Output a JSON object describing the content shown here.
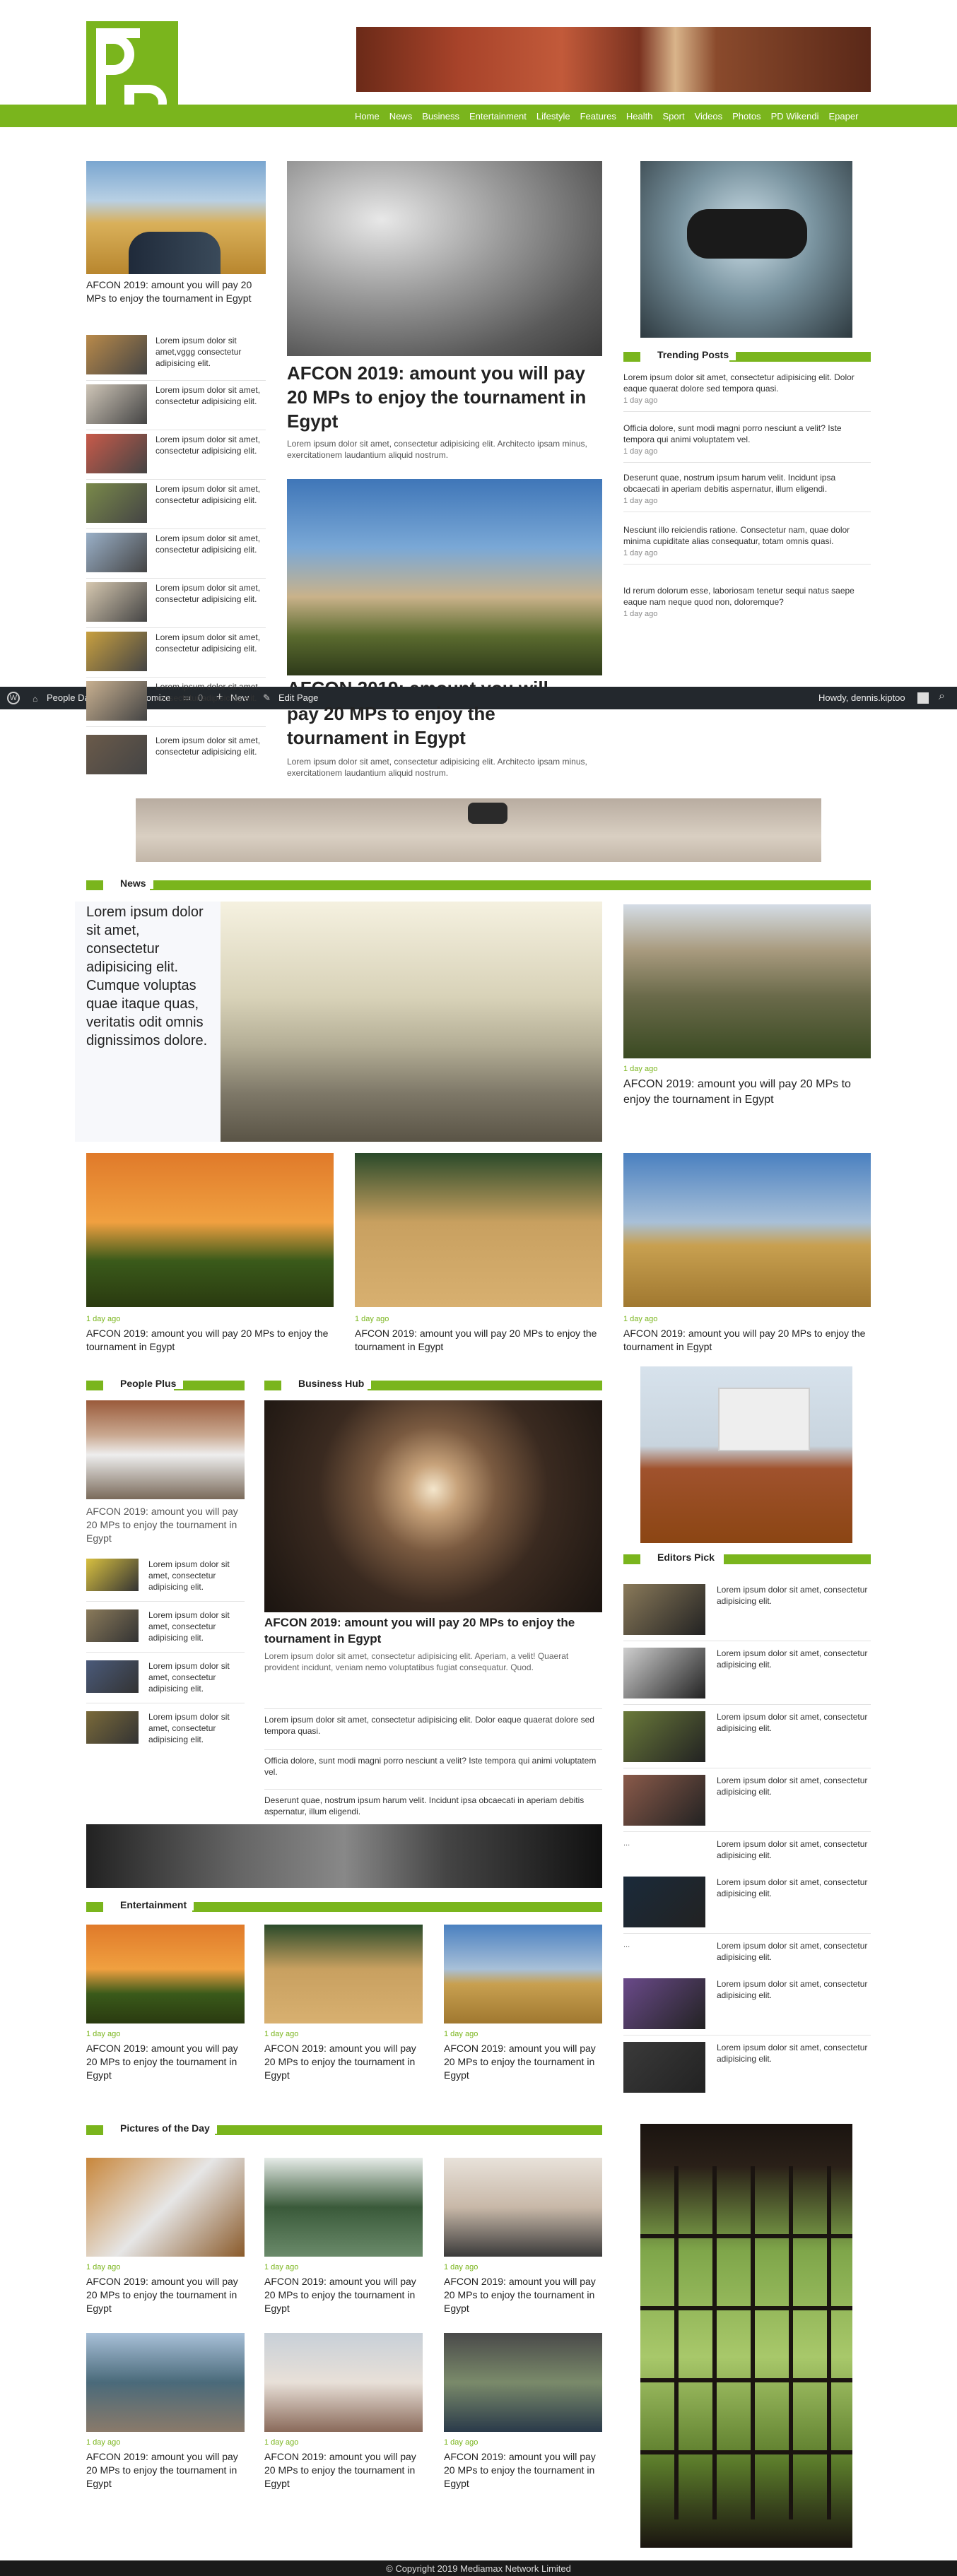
{
  "header": {
    "logo_text": "PD",
    "nav": [
      "Home",
      "News",
      "Business",
      "Entertainment",
      "Lifestyle",
      "Features",
      "Health",
      "Sport",
      "Videos",
      "Photos",
      "PD Wikendi",
      "Epaper"
    ]
  },
  "admin_bar": {
    "site": "People Daily",
    "customize": "Customize",
    "comments": "0",
    "new": "New",
    "edit": "Edit Page",
    "howdy": "Howdy, dennis.kiptoo"
  },
  "left_feature": {
    "caption": "AFCON 2019: amount you will pay 20 MPs to enjoy the tournament in Egypt"
  },
  "left_list": [
    "Lorem ipsum dolor sit amet,vggg consectetur adipisicing elit.",
    "Lorem ipsum dolor sit amet, consectetur adipisicing elit.",
    "Lorem ipsum dolor sit amet, consectetur adipisicing elit.",
    "Lorem ipsum dolor sit amet, consectetur adipisicing elit.",
    "Lorem ipsum dolor sit amet, consectetur adipisicing elit.",
    "Lorem ipsum dolor sit amet, consectetur adipisicing elit.",
    "Lorem ipsum dolor sit amet, consectetur adipisicing elit.",
    "Lorem ipsum dolor sit amet, consectetur adipisicing elit.",
    "Lorem ipsum dolor sit amet, consectetur adipisicing elit."
  ],
  "center_top": {
    "headline": "AFCON 2019: amount you will pay 20 MPs to enjoy the tournament in Egypt",
    "excerpt": "Lorem ipsum dolor sit amet, consectetur adipisicing elit. Architecto ipsam minus, exercitationem laudantium aliquid nostrum."
  },
  "center_second": {
    "headline_line1": "AFCON 2019: amount you will",
    "headline_line2": "pay 20 MPs to enjoy the",
    "headline_line3": "tournament in Egypt",
    "excerpt": "Lorem ipsum dolor sit amet, consectetur adipisicing elit. Architecto ipsam minus, exercitationem laudantium aliquid nostrum."
  },
  "trending": {
    "title": "Trending Posts",
    "items": [
      {
        "text": "Lorem ipsum dolor sit amet, consectetur adipisicing elit. Dolor eaque quaerat dolore sed tempora quasi.",
        "time": "1 day ago"
      },
      {
        "text": "Officia dolore, sunt modi magni porro nesciunt a velit? Iste tempora qui animi voluptatem vel.",
        "time": "1 day ago"
      },
      {
        "text": "Deserunt quae, nostrum ipsum harum velit. Incidunt ipsa obcaecati in aperiam debitis aspernatur, illum eligendi.",
        "time": "1 day ago"
      },
      {
        "text": "Nesciunt illo reiciendis ratione. Consectetur nam, quae dolor minima cupiditate alias consequatur, totam omnis quasi.",
        "time": "1 day ago"
      },
      {
        "text": "Id rerum dolorum esse, laboriosam tenetur sequi natus saepe eaque nam neque quod non, doloremque?",
        "time": "1 day ago"
      }
    ]
  },
  "news": {
    "title": "News",
    "quote": "Lorem ipsum dolor sit amet, consectetur adipisicing elit. Cumque voluptas quae itaque quas, veritatis odit omnis dignissimos dolore.",
    "side": {
      "time": "1 day ago",
      "caption": "AFCON 2019: amount you will pay 20 MPs to enjoy the tournament in Egypt"
    },
    "cards": [
      {
        "time": "1 day ago",
        "caption": "AFCON 2019: amount you will pay 20 MPs to enjoy the tournament in Egypt"
      },
      {
        "time": "1 day ago",
        "caption": "AFCON 2019: amount you will pay 20 MPs to enjoy the tournament in Egypt"
      },
      {
        "time": "1 day ago",
        "caption": "AFCON 2019: amount you will pay 20 MPs to enjoy the tournament in Egypt"
      }
    ]
  },
  "people_plus": {
    "title": "People Plus",
    "caption": "AFCON 2019: amount you will pay 20 MPs to enjoy the tournament in Egypt",
    "items": [
      "Lorem ipsum dolor sit amet, consectetur adipisicing elit.",
      "Lorem ipsum dolor sit amet, consectetur adipisicing elit.",
      "Lorem ipsum dolor sit amet, consectetur adipisicing elit.",
      "Lorem ipsum dolor sit amet, consectetur adipisicing elit."
    ]
  },
  "business_hub": {
    "title": "Business Hub",
    "headline": "AFCON 2019: amount you will pay 20 MPs to enjoy the tournament in Egypt",
    "excerpt": "Lorem ipsum dolor sit amet, consectetur adipisicing elit. Aperiam, a velit! Quaerat provident incidunt, veniam nemo voluptatibus fugiat consequatur. Quod.",
    "items": [
      "Lorem ipsum dolor sit amet, consectetur adipisicing elit. Dolor eaque quaerat dolore sed tempora quasi.",
      "Officia dolore, sunt modi magni porro nesciunt a velit? Iste tempora qui animi voluptatem vel.",
      "Deserunt quae, nostrum ipsum harum velit. Incidunt ipsa obcaecati in aperiam debitis aspernatur, illum eligendi."
    ]
  },
  "editors_pick": {
    "title": "Editors Pick",
    "items": [
      {
        "text": "Lorem ipsum dolor sit amet, consectetur adipisicing elit.",
        "bullet": ""
      },
      {
        "text": "Lorem ipsum dolor sit amet, consectetur adipisicing elit.",
        "bullet": ""
      },
      {
        "text": "Lorem ipsum dolor sit amet, consectetur adipisicing elit.",
        "bullet": ""
      },
      {
        "text": "Lorem ipsum dolor sit amet, consectetur adipisicing elit.",
        "bullet": ""
      },
      {
        "text": "Lorem ipsum dolor sit amet, consectetur adipisicing elit.",
        "bullet": "..."
      },
      {
        "text": "Lorem ipsum dolor sit amet, consectetur adipisicing elit.",
        "bullet": ""
      },
      {
        "text": "Lorem ipsum dolor sit amet, consectetur adipisicing elit.",
        "bullet": "..."
      },
      {
        "text": "Lorem ipsum dolor sit amet, consectetur adipisicing elit.",
        "bullet": ""
      },
      {
        "text": "Lorem ipsum dolor sit amet, consectetur adipisicing elit.",
        "bullet": ""
      }
    ]
  },
  "entertainment": {
    "title": "Entertainment",
    "cards": [
      {
        "time": "1 day ago",
        "caption": "AFCON 2019: amount you will pay 20 MPs to enjoy the tournament in Egypt"
      },
      {
        "time": "1 day ago",
        "caption": "AFCON 2019: amount you will pay 20 MPs to enjoy the tournament in Egypt"
      },
      {
        "time": "1 day ago",
        "caption": "AFCON 2019: amount you will pay 20 MPs to enjoy the tournament in Egypt"
      }
    ]
  },
  "pictures": {
    "title": "Pictures of the Day",
    "cards": [
      {
        "time": "1 day ago",
        "caption": "AFCON 2019: amount you will pay 20 MPs to enjoy the tournament in Egypt"
      },
      {
        "time": "1 day ago",
        "caption": "AFCON 2019: amount you will pay 20 MPs to enjoy the tournament in Egypt"
      },
      {
        "time": "1 day ago",
        "caption": "AFCON 2019: amount you will pay 20 MPs to enjoy the tournament in Egypt"
      },
      {
        "time": "1 day ago",
        "caption": "AFCON 2019: amount you will pay 20 MPs to enjoy the tournament in Egypt"
      },
      {
        "time": "1 day ago",
        "caption": "AFCON 2019: amount you will pay 20 MPs to enjoy the tournament in Egypt"
      },
      {
        "time": "1 day ago",
        "caption": "AFCON 2019: amount you will pay 20 MPs to enjoy the tournament in Egypt"
      }
    ]
  },
  "footer": {
    "copyright": "© Copyright 2019 Mediamax Network Limited"
  },
  "colors": {
    "brand_green": "#7ab51d",
    "admin_bar": "#23282d",
    "footer": "#1a1a1a"
  }
}
